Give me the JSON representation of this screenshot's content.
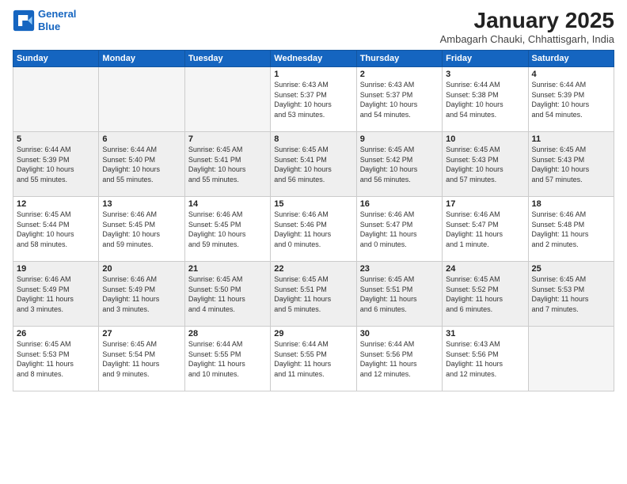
{
  "header": {
    "logo_line1": "General",
    "logo_line2": "Blue",
    "main_title": "January 2025",
    "subtitle": "Ambagarh Chauki, Chhattisgarh, India"
  },
  "days_of_week": [
    "Sunday",
    "Monday",
    "Tuesday",
    "Wednesday",
    "Thursday",
    "Friday",
    "Saturday"
  ],
  "weeks": [
    [
      {
        "day": "",
        "info": ""
      },
      {
        "day": "",
        "info": ""
      },
      {
        "day": "",
        "info": ""
      },
      {
        "day": "1",
        "info": "Sunrise: 6:43 AM\nSunset: 5:37 PM\nDaylight: 10 hours\nand 53 minutes."
      },
      {
        "day": "2",
        "info": "Sunrise: 6:43 AM\nSunset: 5:37 PM\nDaylight: 10 hours\nand 54 minutes."
      },
      {
        "day": "3",
        "info": "Sunrise: 6:44 AM\nSunset: 5:38 PM\nDaylight: 10 hours\nand 54 minutes."
      },
      {
        "day": "4",
        "info": "Sunrise: 6:44 AM\nSunset: 5:39 PM\nDaylight: 10 hours\nand 54 minutes."
      }
    ],
    [
      {
        "day": "5",
        "info": "Sunrise: 6:44 AM\nSunset: 5:39 PM\nDaylight: 10 hours\nand 55 minutes."
      },
      {
        "day": "6",
        "info": "Sunrise: 6:44 AM\nSunset: 5:40 PM\nDaylight: 10 hours\nand 55 minutes."
      },
      {
        "day": "7",
        "info": "Sunrise: 6:45 AM\nSunset: 5:41 PM\nDaylight: 10 hours\nand 55 minutes."
      },
      {
        "day": "8",
        "info": "Sunrise: 6:45 AM\nSunset: 5:41 PM\nDaylight: 10 hours\nand 56 minutes."
      },
      {
        "day": "9",
        "info": "Sunrise: 6:45 AM\nSunset: 5:42 PM\nDaylight: 10 hours\nand 56 minutes."
      },
      {
        "day": "10",
        "info": "Sunrise: 6:45 AM\nSunset: 5:43 PM\nDaylight: 10 hours\nand 57 minutes."
      },
      {
        "day": "11",
        "info": "Sunrise: 6:45 AM\nSunset: 5:43 PM\nDaylight: 10 hours\nand 57 minutes."
      }
    ],
    [
      {
        "day": "12",
        "info": "Sunrise: 6:45 AM\nSunset: 5:44 PM\nDaylight: 10 hours\nand 58 minutes."
      },
      {
        "day": "13",
        "info": "Sunrise: 6:46 AM\nSunset: 5:45 PM\nDaylight: 10 hours\nand 59 minutes."
      },
      {
        "day": "14",
        "info": "Sunrise: 6:46 AM\nSunset: 5:45 PM\nDaylight: 10 hours\nand 59 minutes."
      },
      {
        "day": "15",
        "info": "Sunrise: 6:46 AM\nSunset: 5:46 PM\nDaylight: 11 hours\nand 0 minutes."
      },
      {
        "day": "16",
        "info": "Sunrise: 6:46 AM\nSunset: 5:47 PM\nDaylight: 11 hours\nand 0 minutes."
      },
      {
        "day": "17",
        "info": "Sunrise: 6:46 AM\nSunset: 5:47 PM\nDaylight: 11 hours\nand 1 minute."
      },
      {
        "day": "18",
        "info": "Sunrise: 6:46 AM\nSunset: 5:48 PM\nDaylight: 11 hours\nand 2 minutes."
      }
    ],
    [
      {
        "day": "19",
        "info": "Sunrise: 6:46 AM\nSunset: 5:49 PM\nDaylight: 11 hours\nand 3 minutes."
      },
      {
        "day": "20",
        "info": "Sunrise: 6:46 AM\nSunset: 5:49 PM\nDaylight: 11 hours\nand 3 minutes."
      },
      {
        "day": "21",
        "info": "Sunrise: 6:45 AM\nSunset: 5:50 PM\nDaylight: 11 hours\nand 4 minutes."
      },
      {
        "day": "22",
        "info": "Sunrise: 6:45 AM\nSunset: 5:51 PM\nDaylight: 11 hours\nand 5 minutes."
      },
      {
        "day": "23",
        "info": "Sunrise: 6:45 AM\nSunset: 5:51 PM\nDaylight: 11 hours\nand 6 minutes."
      },
      {
        "day": "24",
        "info": "Sunrise: 6:45 AM\nSunset: 5:52 PM\nDaylight: 11 hours\nand 6 minutes."
      },
      {
        "day": "25",
        "info": "Sunrise: 6:45 AM\nSunset: 5:53 PM\nDaylight: 11 hours\nand 7 minutes."
      }
    ],
    [
      {
        "day": "26",
        "info": "Sunrise: 6:45 AM\nSunset: 5:53 PM\nDaylight: 11 hours\nand 8 minutes."
      },
      {
        "day": "27",
        "info": "Sunrise: 6:45 AM\nSunset: 5:54 PM\nDaylight: 11 hours\nand 9 minutes."
      },
      {
        "day": "28",
        "info": "Sunrise: 6:44 AM\nSunset: 5:55 PM\nDaylight: 11 hours\nand 10 minutes."
      },
      {
        "day": "29",
        "info": "Sunrise: 6:44 AM\nSunset: 5:55 PM\nDaylight: 11 hours\nand 11 minutes."
      },
      {
        "day": "30",
        "info": "Sunrise: 6:44 AM\nSunset: 5:56 PM\nDaylight: 11 hours\nand 12 minutes."
      },
      {
        "day": "31",
        "info": "Sunrise: 6:43 AM\nSunset: 5:56 PM\nDaylight: 11 hours\nand 12 minutes."
      },
      {
        "day": "",
        "info": ""
      }
    ]
  ]
}
